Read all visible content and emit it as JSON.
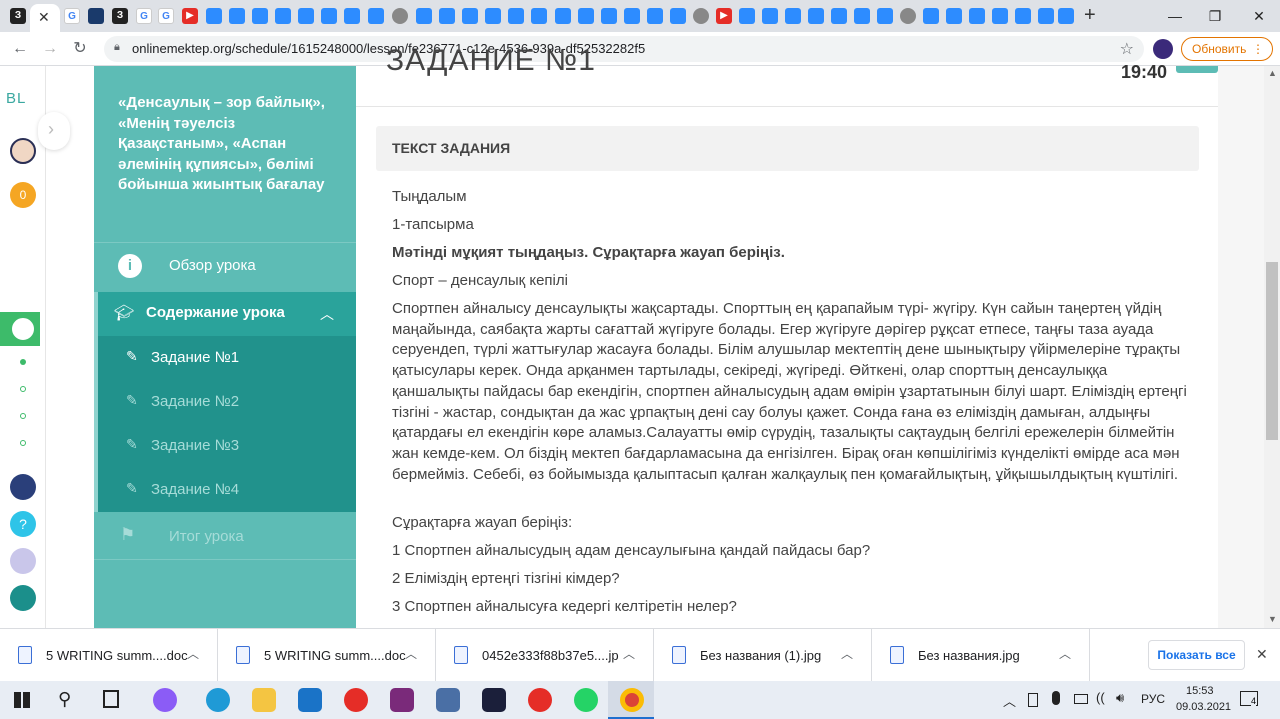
{
  "browser": {
    "url": "onlinemektep.org/schedule/1615248000/lesson/fe236771-c12e-4536-939a-df52532282f5",
    "update_label": "Обновить",
    "new_tab_label": "+"
  },
  "rail": {
    "logo_text": "BL",
    "badge_count": "0",
    "chevron_icon": "chevron-right-icon"
  },
  "course_nav": {
    "title": "«Денсаулық – зор байлық», «Менің тәуелсіз Қазақстаным», «Аспан әлемінің құпиясы», бөлімі бойынша жиынтық бағалау",
    "overview_label": "Обзор урока",
    "content_label": "Содержание урока",
    "tasks": [
      "Задание №1",
      "Задание №2",
      "Задание №3",
      "Задание №4"
    ],
    "summary_label": "Итог урока"
  },
  "content": {
    "page_title_partial": "ЗАДАНИЕ №1",
    "time": "19:40",
    "task_header": "ТЕКСТ ЗАДАНИЯ",
    "line1": "Тыңдалым",
    "line2": "1-тапсырма",
    "instruction": "Мәтінді мұқият тыңдаңыз. Сұрақтарға жауап беріңіз.",
    "text_title": "Спорт – денсаулық кепілі",
    "body": "Спортпен айналысу денсаулықты жақсартады. Спорттың ең қарапайым түрі- жүгіру. Күн сайын таңертең үйдің маңайында, саябақта жарты сағаттай жүгіруге болады. Егер жүгіруге дәрігер рұқсат етпесе, таңғы таза ауада серуендеп, түрлі жаттығулар жасауға болады. Білім алушылар мектептің дене шынықтыру үйірмелеріне тұрақты қатысулары керек. Онда арқанмен тартылады, секіреді, жүгіреді. Өйткені, олар спорттың денсаулыққа қаншалықты пайдасы бар екендігін, спортпен айналысудың адам өмірін ұзартатынын білуі шарт. Еліміздің ертеңгі тізгіні - жастар, сондықтан да жас ұрпақтың дені сау болуы қажет. Сонда ғана өз еліміздің дамыған, алдыңғы қатардағы ел екендігін көре аламыз.Салауатты өмір сүрудің, тазалықты сақтаудың белгілі ережелерін білмейтін жан кемде-кем. Ол біздің мектеп бағдарламасына да енгізілген. Бірақ оған көпшілігіміз күнделікті өмірде аса мән бермейміз. Себебі, өз бойымызда қалыптасып қалған жалқаулық пен қомағайлықтың, ұйқышылдықтың күштілігі.",
    "question_intro": "Сұрақтарға жауап беріңіз:",
    "questions": [
      "1 Спортпен айналысудың адам денсаулығына қандай пайдасы бар?",
      "2 Еліміздің ертеңгі тізгіні кімдер?",
      "3 Спортпен айналысуға кедергі келтіретін нелер?"
    ]
  },
  "downloads": {
    "items": [
      "5 WRITING summ....doc",
      "5 WRITING summ....doc",
      "0452e333f88b37e5....jp",
      "Без названия (1).jpg",
      "Без названия.jpg"
    ],
    "show_all": "Показать все"
  },
  "taskbar": {
    "lang": "РУС",
    "time": "15:53",
    "date": "09.03.2021",
    "notif_count": "4"
  },
  "colors": {
    "teal": "#5dbcb5",
    "teal_dark": "#21928c",
    "accent_orange": "#e37400"
  }
}
